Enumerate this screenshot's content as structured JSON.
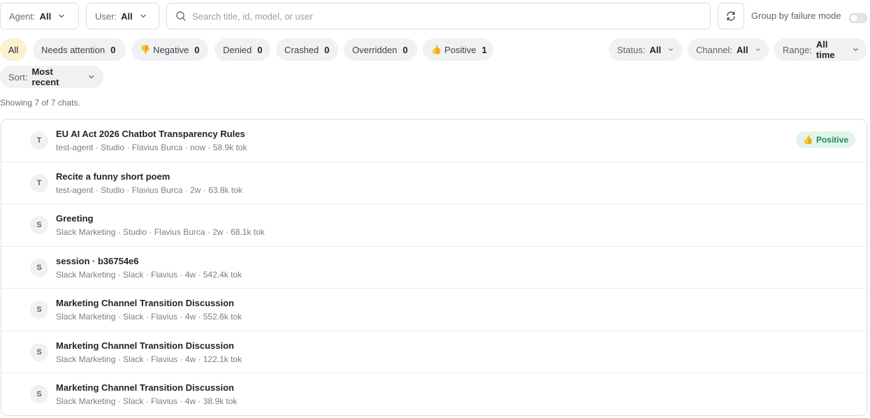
{
  "toolbar": {
    "agent_label": "Agent:",
    "agent_value": "All",
    "user_label": "User:",
    "user_value": "All",
    "search_placeholder": "Search title, id, model, or user",
    "group_label": "Group by failure mode",
    "group_toggle_on": false
  },
  "chips": [
    {
      "label": "All",
      "count": ""
    },
    {
      "label": "Needs attention",
      "count": "0"
    },
    {
      "label": "Negative",
      "emoji": "👎",
      "count": "0"
    },
    {
      "label": "Denied",
      "count": "0"
    },
    {
      "label": "Crashed",
      "count": "0"
    },
    {
      "label": "Overridden",
      "count": "0"
    },
    {
      "label": "Positive",
      "emoji": "👍",
      "count": "1"
    }
  ],
  "filters": {
    "status_label": "Status:",
    "status_value": "All",
    "channel_label": "Channel:",
    "channel_value": "All",
    "range_label": "Range:",
    "range_value": "All time",
    "sort_label": "Sort:",
    "sort_value": "Most recent"
  },
  "showing": "Showing 7 of 7 chats.",
  "chats": [
    {
      "initial": "T",
      "title": "EU AI Act 2026 Chatbot Transparency Rules",
      "meta": "test-agent · Studio · Flavius Burca · now · 58.9k tok",
      "badge": "Positive",
      "badge_emoji": "👍"
    },
    {
      "initial": "T",
      "title": "Recite a funny short poem",
      "meta": "test-agent · Studio · Flavius Burca · 2w · 63.8k tok"
    },
    {
      "initial": "S",
      "title": "Greeting",
      "meta": "Slack Marketing · Studio · Flavius Burca · 2w · 68.1k tok"
    },
    {
      "initial": "S",
      "title": "session · b36754e6",
      "meta": "Slack Marketing · Slack · Flavius · 4w · 542.4k tok"
    },
    {
      "initial": "S",
      "title": "Marketing Channel Transition Discussion",
      "meta": "Slack Marketing · Slack · Flavius · 4w · 552.6k tok"
    },
    {
      "initial": "S",
      "title": "Marketing Channel Transition Discussion",
      "meta": "Slack Marketing · Slack · Flavius · 4w · 122.1k tok"
    },
    {
      "initial": "S",
      "title": "Marketing Channel Transition Discussion",
      "meta": "Slack Marketing · Slack · Flavius · 4w · 38.9k tok"
    }
  ],
  "colors": {
    "active_chip": "#fbf0cf",
    "chip_bg": "#f0f1f3",
    "positive_bg": "#e3f4ec",
    "positive_text": "#1f8a5a"
  }
}
